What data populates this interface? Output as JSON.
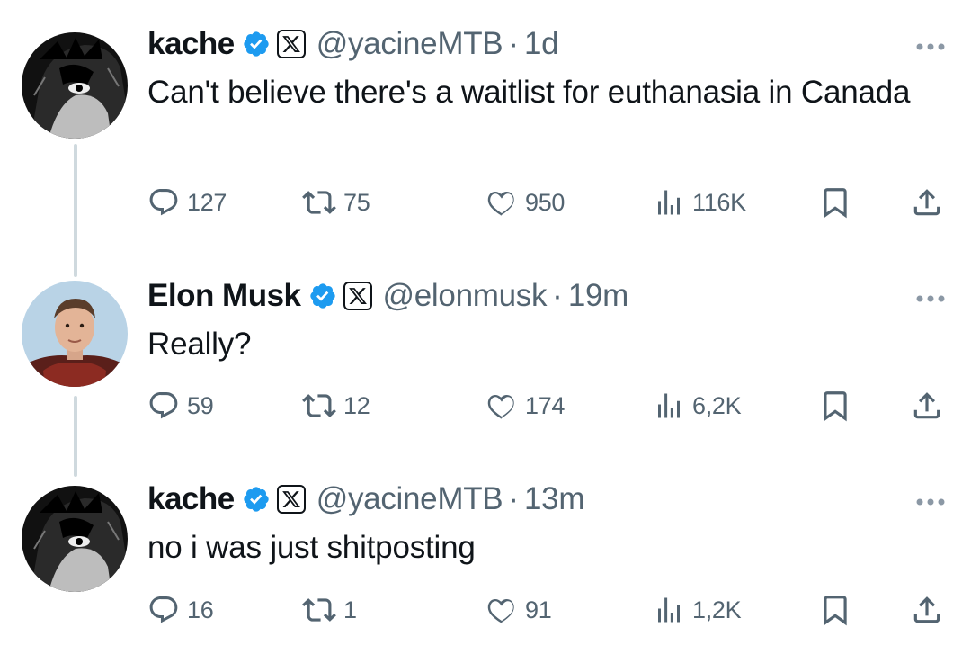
{
  "tweets": [
    {
      "name": "kache",
      "handle": "@yacineMTB",
      "dot": "·",
      "time": "1d",
      "text": "Can't believe there's a waitlist for euthanasia in Canada",
      "replies": "127",
      "retweets": "75",
      "likes": "950",
      "views": "116K"
    },
    {
      "name": "Elon Musk",
      "handle": "@elonmusk",
      "dot": "·",
      "time": "19m",
      "text": "Really?",
      "replies": "59",
      "retweets": "12",
      "likes": "174",
      "views": "6,2K"
    },
    {
      "name": "kache",
      "handle": "@yacineMTB",
      "dot": "·",
      "time": "13m",
      "text": "no i was just shitposting",
      "replies": "16",
      "retweets": "1",
      "likes": "91",
      "views": "1,2K"
    }
  ],
  "icons": {
    "verified": "verified-badge-icon",
    "x_logo": "x-logo-icon",
    "reply": "reply-icon",
    "retweet": "retweet-icon",
    "like": "heart-icon",
    "views": "views-icon",
    "bookmark": "bookmark-icon",
    "share": "share-icon",
    "more": "more-icon"
  },
  "colors": {
    "verified": "#1d9bf0",
    "text": "#0f1419",
    "secondary": "#536471",
    "thread_line": "#cfd9de"
  }
}
